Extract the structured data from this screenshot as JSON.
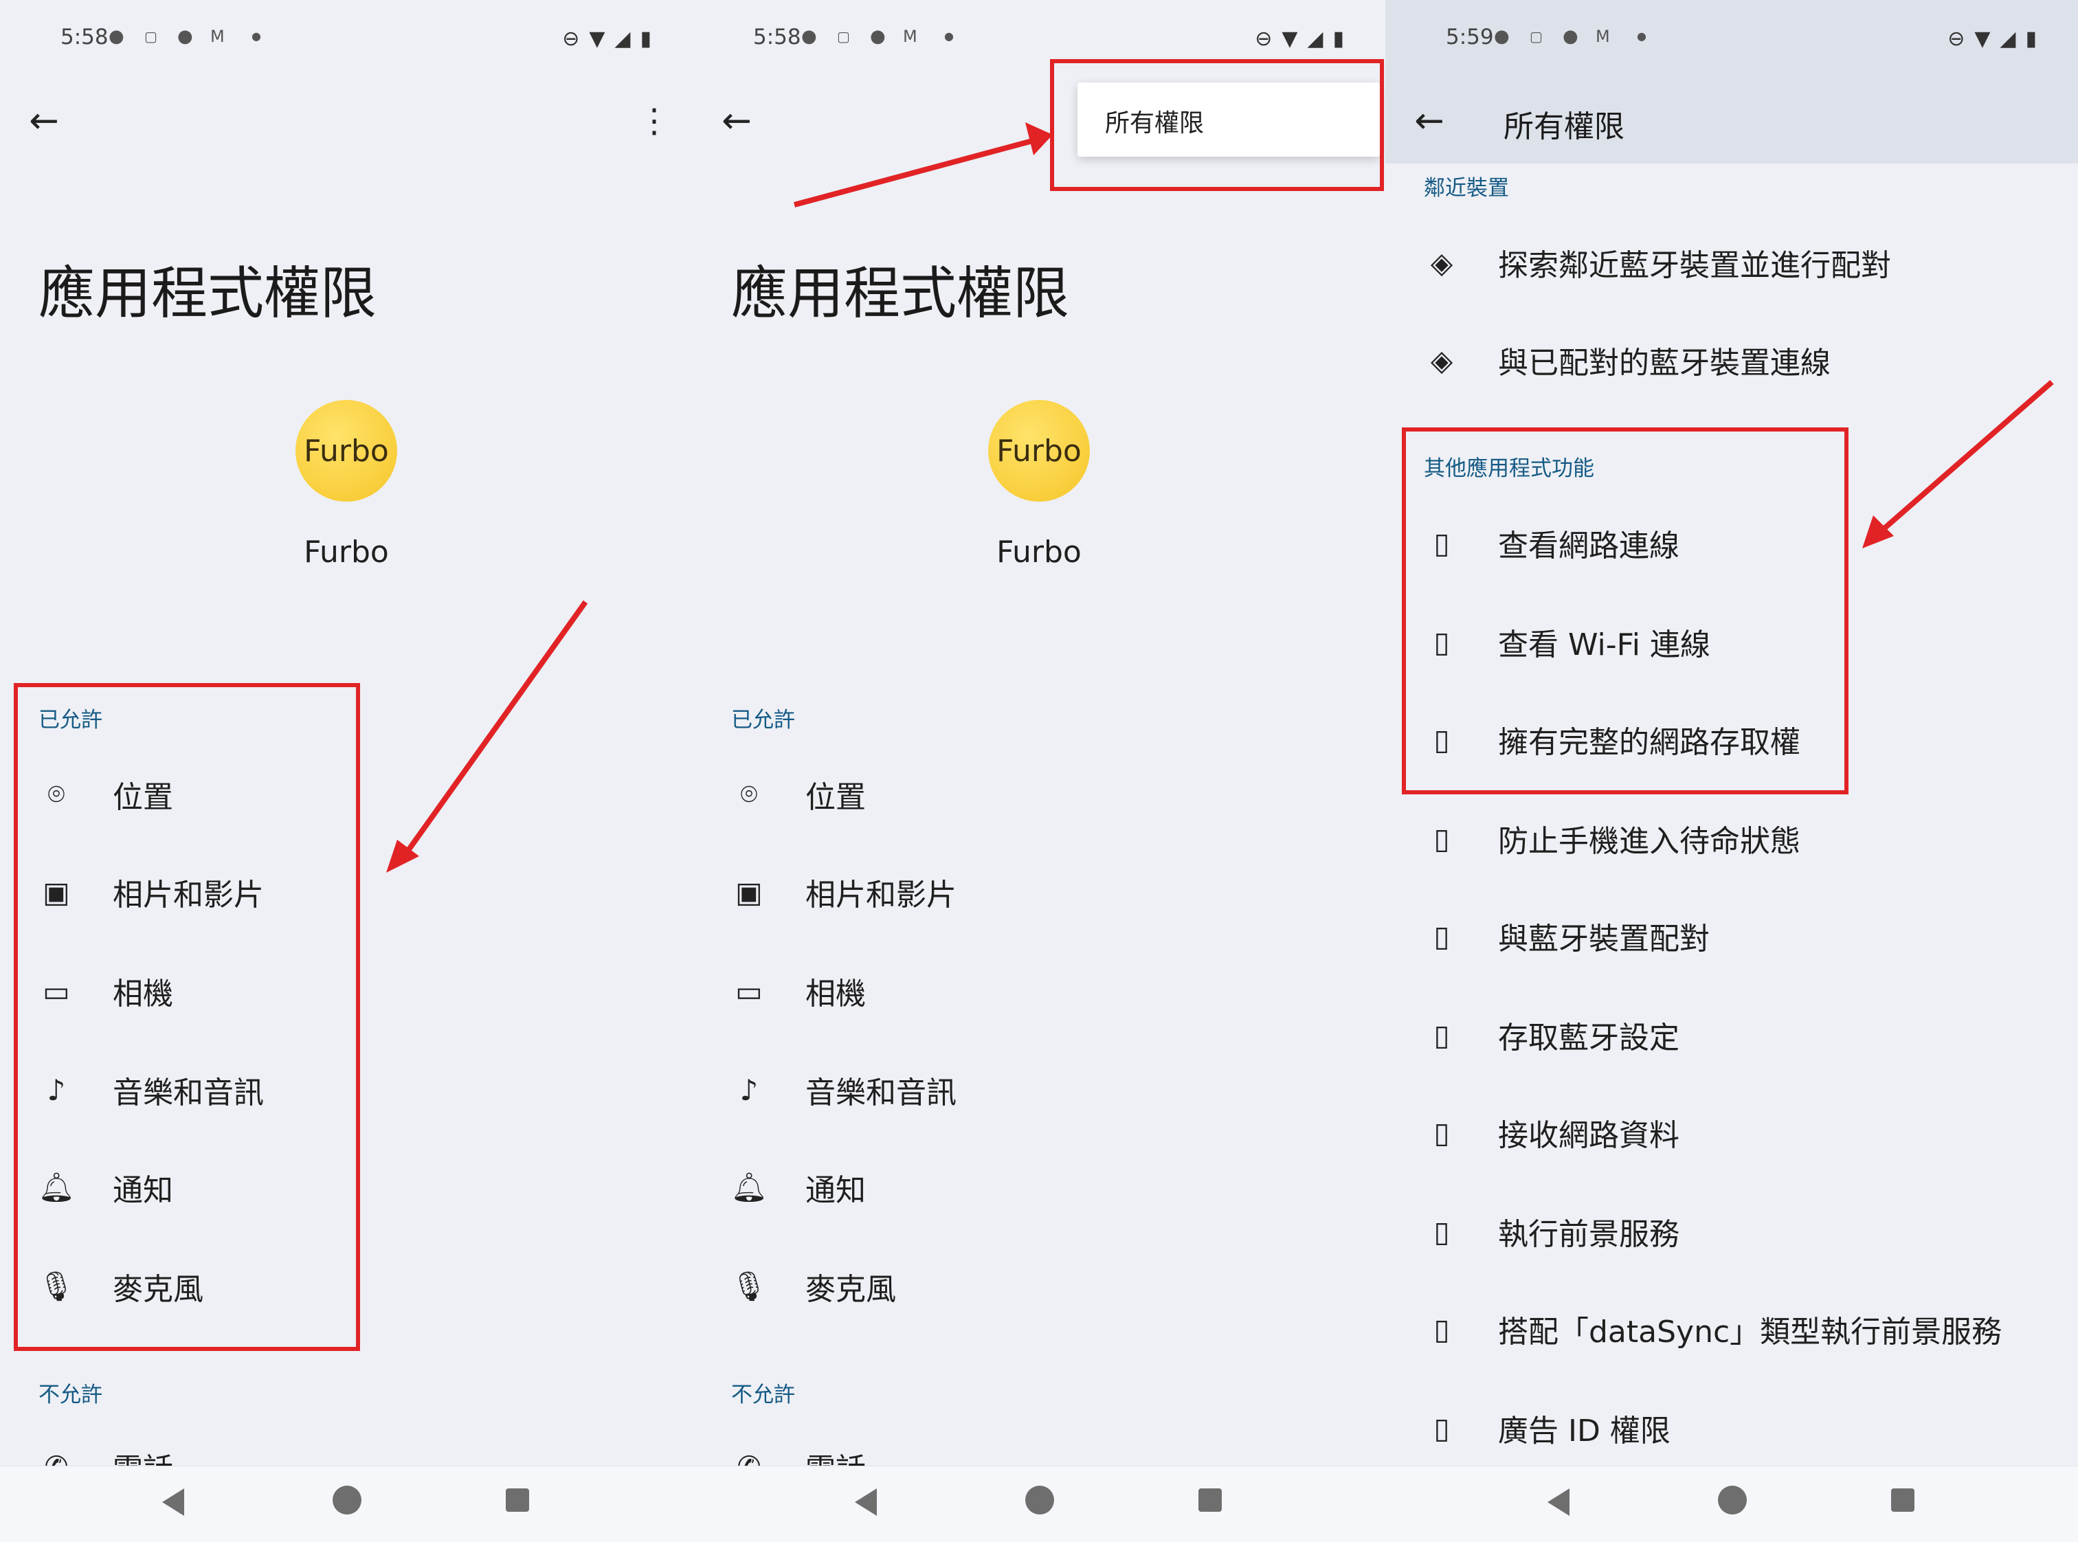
{
  "panel1": {
    "status": {
      "time": "5:58"
    },
    "title": "應用程式權限",
    "app": {
      "logo_text": "Furbo",
      "name": "Furbo"
    },
    "allowed_header": "已允許",
    "allowed": [
      "位置",
      "相片和影片",
      "相機",
      "音樂和音訊",
      "通知",
      "麥克風"
    ],
    "denied_header": "不允許",
    "denied": [
      "電話"
    ]
  },
  "panel2": {
    "status": {
      "time": "5:58"
    },
    "menu_item": "所有權限",
    "title": "應用程式權限",
    "app": {
      "logo_text": "Furbo",
      "name": "Furbo"
    },
    "allowed_header": "已允許",
    "allowed": [
      "位置",
      "相片和影片",
      "相機",
      "音樂和音訊",
      "通知",
      "麥克風"
    ],
    "denied_header": "不允許",
    "denied": [
      "電話"
    ]
  },
  "panel3": {
    "status": {
      "time": "5:59"
    },
    "title": "所有權限",
    "nearby_header": "鄰近裝置",
    "nearby": [
      "探索鄰近藍牙裝置並進行配對",
      "與已配對的藍牙裝置連線"
    ],
    "other_header": "其他應用程式功能",
    "other": [
      "查看網路連線",
      "查看 Wi-Fi 連線",
      "擁有完整的網路存取權",
      "防止手機進入待命狀態",
      "與藍牙裝置配對",
      "存取藍牙設定",
      "接收網路資料",
      "執行前景服務",
      "搭配「dataSync」類型執行前景服務",
      "廣告 ID 權限"
    ]
  },
  "colors": {
    "accent": "#155a85",
    "annotation": "#e12326",
    "logo": "#f6c528",
    "background": "#eef0f5"
  }
}
